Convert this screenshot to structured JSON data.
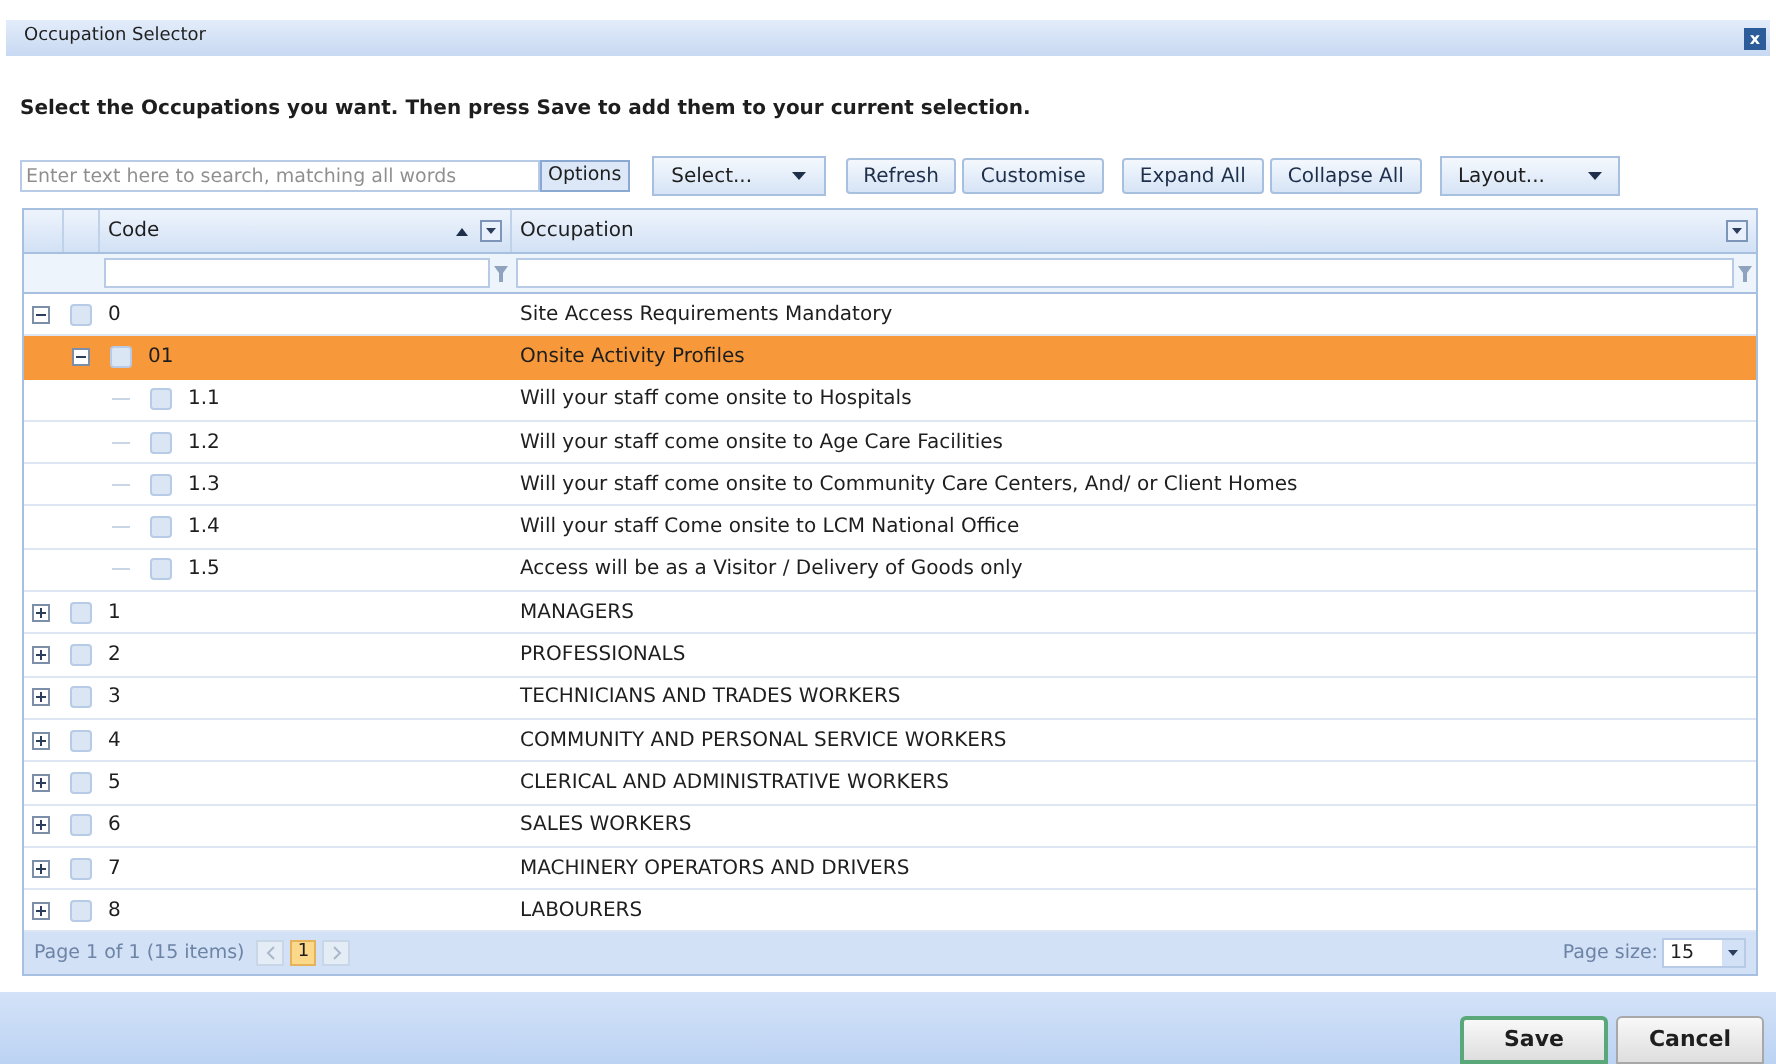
{
  "window": {
    "title": "Occupation Selector",
    "close": "x"
  },
  "instruction": "Select the Occupations you want. Then press Save to add them to your current selection.",
  "toolbar": {
    "search": {
      "placeholder": "Enter text here to search, matching all words"
    },
    "options": "Options",
    "select": "Select...",
    "buttons": [
      "Refresh",
      "Customise"
    ],
    "expand_buttons": [
      "Expand All",
      "Collapse All"
    ],
    "layout": "Layout..."
  },
  "table": {
    "columns": [
      {
        "label": "Code",
        "sorted": true
      },
      {
        "label": "Occupation",
        "sorted": false
      }
    ],
    "rows": [
      {
        "code": "0",
        "occupation": "Site Access Requirements Mandatory",
        "expanded": true,
        "selected": false,
        "children": [
          {
            "code": "01",
            "occupation": "Onsite Activity Profiles",
            "expanded": true,
            "selected": true,
            "children": [
              {
                "code": "1.1",
                "occupation": "Will your staff come onsite to Hospitals",
                "selected": false
              },
              {
                "code": "1.2",
                "occupation": "Will your staff come onsite to Age Care Facilities",
                "selected": false
              },
              {
                "code": "1.3",
                "occupation": "Will your staff come onsite to Community Care Centers, And/ or Client Homes",
                "selected": false
              },
              {
                "code": "1.4",
                "occupation": "Will your staff Come onsite to LCM National Office",
                "selected": false
              },
              {
                "code": "1.5",
                "occupation": "Access will be as a Visitor / Delivery of Goods only",
                "selected": false
              }
            ]
          }
        ]
      },
      {
        "code": "1",
        "occupation": "MANAGERS",
        "expanded": false,
        "selected": false,
        "children": []
      },
      {
        "code": "2",
        "occupation": "PROFESSIONALS",
        "expanded": false,
        "selected": false,
        "children": []
      },
      {
        "code": "3",
        "occupation": "TECHNICIANS AND TRADES WORKERS",
        "expanded": false,
        "selected": false,
        "children": []
      },
      {
        "code": "4",
        "occupation": "COMMUNITY AND PERSONAL SERVICE WORKERS",
        "expanded": false,
        "selected": false,
        "children": []
      },
      {
        "code": "5",
        "occupation": "CLERICAL AND ADMINISTRATIVE WORKERS",
        "expanded": false,
        "selected": false,
        "children": []
      },
      {
        "code": "6",
        "occupation": "SALES WORKERS",
        "expanded": false,
        "selected": false,
        "children": []
      },
      {
        "code": "7",
        "occupation": "MACHINERY OPERATORS AND DRIVERS",
        "expanded": false,
        "selected": false,
        "children": []
      },
      {
        "code": "8",
        "occupation": "LABOURERS",
        "expanded": false,
        "selected": false,
        "children": []
      }
    ]
  },
  "pager": {
    "summary": "Page 1 of 1 (15 items)",
    "pages": [
      {
        "label": "1",
        "selected": true
      }
    ],
    "page_size_label": "Page size:",
    "page_size": "15"
  },
  "footer": {
    "buttons": [
      "Save",
      "Cancel"
    ]
  }
}
